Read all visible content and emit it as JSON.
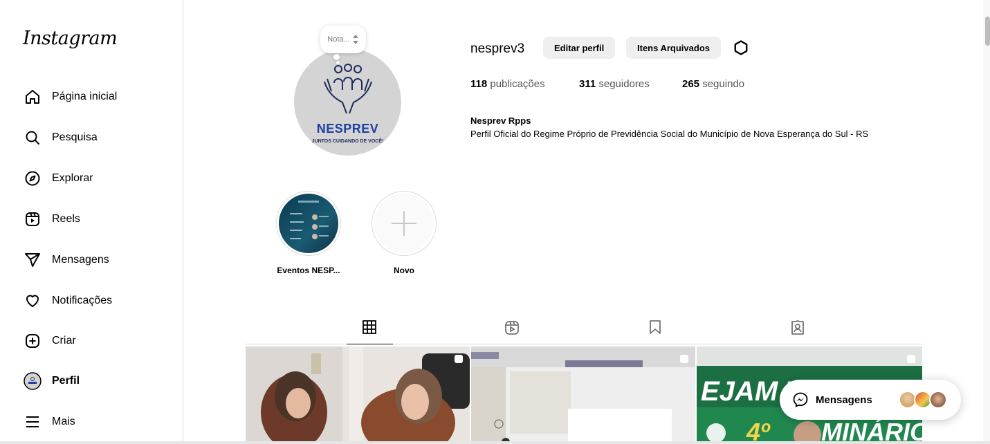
{
  "sidebar": {
    "logo": "Instagram",
    "items": [
      {
        "label": "Página inicial",
        "icon": "home-icon"
      },
      {
        "label": "Pesquisa",
        "icon": "search-icon"
      },
      {
        "label": "Explorar",
        "icon": "compass-icon"
      },
      {
        "label": "Reels",
        "icon": "reels-icon"
      },
      {
        "label": "Mensagens",
        "icon": "paper-plane-icon"
      },
      {
        "label": "Notificações",
        "icon": "heart-icon"
      },
      {
        "label": "Criar",
        "icon": "plus-square-icon"
      },
      {
        "label": "Perfil",
        "icon": "avatar-icon",
        "active": true
      },
      {
        "label": "Mais",
        "icon": "menu-icon"
      }
    ]
  },
  "profile": {
    "note": "Nota...",
    "avatar_brand": "NESPREV",
    "avatar_tagline": "JUNTOS CUIDANDO DE VOCÊ!",
    "username": "nesprev3",
    "edit_button": "Editar perfil",
    "archive_button": "Itens Arquivados",
    "stats": {
      "posts_count": "118",
      "posts_label": "publicações",
      "followers_count": "311",
      "followers_label": "seguidores",
      "following_count": "265",
      "following_label": "seguindo"
    },
    "full_name": "Nesprev Rpps",
    "bio": "Perfil Oficial do Regime Próprio de Previdência Social do Município de Nova Esperança do Sul - RS"
  },
  "highlights": [
    {
      "label": "Eventos NESP..."
    },
    {
      "label": "Novo"
    }
  ],
  "tabs": [
    {
      "icon": "grid-icon",
      "active": true
    },
    {
      "icon": "reels-tab-icon"
    },
    {
      "icon": "bookmark-icon"
    },
    {
      "icon": "tagged-icon"
    }
  ],
  "posts": {
    "post3_overlay_1": "EJAM TO",
    "post3_overlay_2": "4º",
    "post3_overlay_3": "MINÁRIO NAC"
  },
  "messages_pill": {
    "label": "Mensagens",
    "icon": "messenger-icon"
  },
  "colors": {
    "brand_blue": "#1d3fa0",
    "border": "#dbdbdb",
    "button_bg": "#efefef"
  }
}
